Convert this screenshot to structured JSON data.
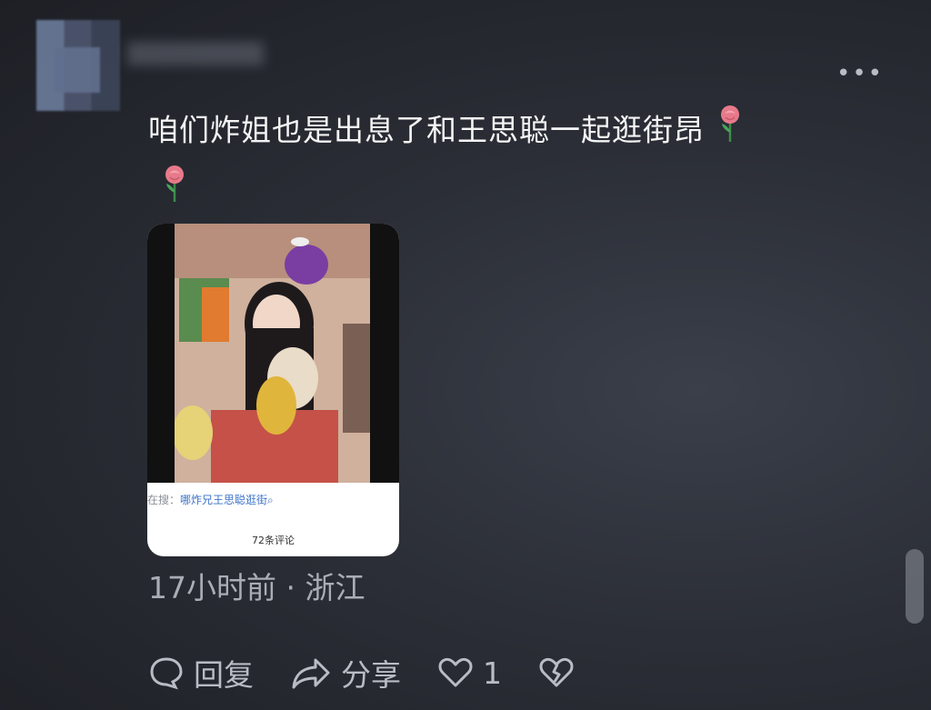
{
  "post": {
    "text": "咱们炸姐也是出息了和王思聪一起逛街昂",
    "emoji_name": "rose",
    "meta": "17小时前 · 浙江"
  },
  "media": {
    "search_prefix": "在搜：",
    "search_query": "哪炸兄王思聪逛街",
    "comments_count": "72条评论"
  },
  "actions": {
    "reply_label": "回复",
    "share_label": "分享",
    "like_count": "1"
  },
  "icons": [
    "more-icon",
    "rose-icon",
    "search-icon",
    "reply-icon",
    "share-icon",
    "like-icon",
    "dislike-icon"
  ],
  "colors": {
    "background": "#2b2e36",
    "text": "#f4f4f4",
    "muted": "#a9adb5",
    "link": "#3d73c9"
  }
}
